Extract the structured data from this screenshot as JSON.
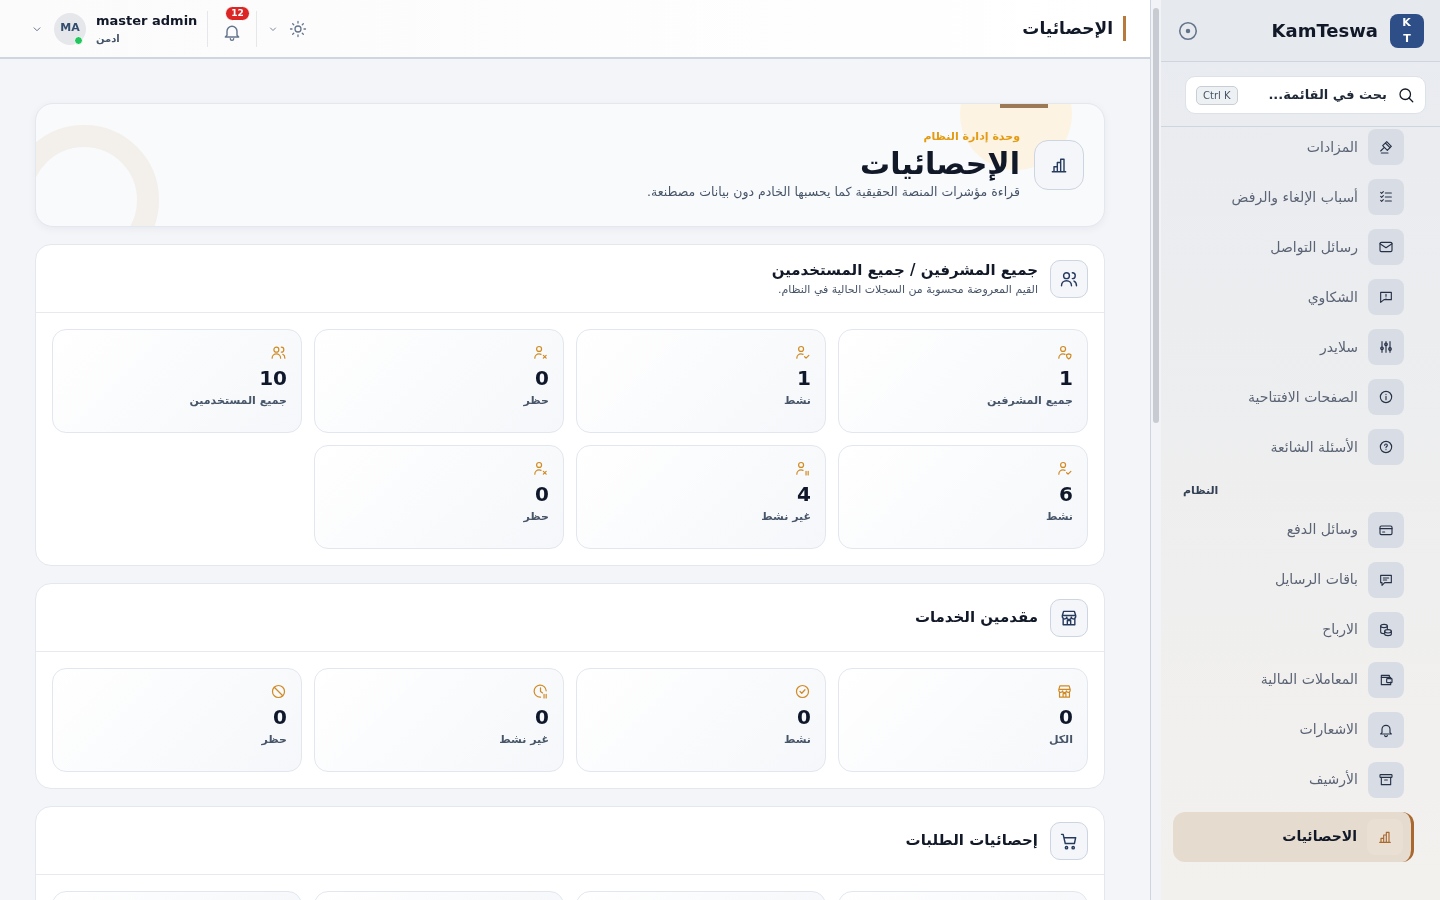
{
  "header": {
    "title": "الإحصائيات",
    "user": {
      "name": "master admin",
      "role": "ادمن",
      "initials": "MA",
      "online": true
    },
    "notifications": {
      "count": "12"
    }
  },
  "hero": {
    "eyebrow": "وحدة إدارة النظام",
    "title": "الإحصائيات",
    "description": "قراءة مؤشرات المنصة الحقيقية كما يحسبها الخادم دون بيانات مصطنعة."
  },
  "sections": [
    {
      "title": "جميع المشرفين / جميع المستخدمين",
      "subtitle": "القيم المعروضة محسوبة من السجلات الحالية في النظام.",
      "cards": [
        {
          "kind": "stat",
          "value": "1",
          "label": "جميع المشرفين"
        },
        {
          "kind": "stat",
          "value": "1",
          "label": "نشط"
        },
        {
          "kind": "stat",
          "value": "0",
          "label": "حظر"
        },
        {
          "kind": "stat",
          "value": "10",
          "label": "جميع المستخدمين"
        },
        {
          "kind": "stat",
          "value": "6",
          "label": "نشط"
        },
        {
          "kind": "stat",
          "value": "4",
          "label": "غير نشط"
        },
        {
          "kind": "stat",
          "value": "0",
          "label": "حظر"
        }
      ]
    },
    {
      "title": "مقدمين الخدمات",
      "cards": [
        {
          "kind": "stat",
          "value": "0",
          "label": "الكل"
        },
        {
          "kind": "stat",
          "value": "0",
          "label": "نشط"
        },
        {
          "kind": "stat",
          "value": "0",
          "label": "غير نشط"
        },
        {
          "kind": "stat",
          "value": "0",
          "label": "حظر"
        }
      ]
    },
    {
      "title": "إحصائيات الطلبات",
      "cards": [
        {
          "kind": "cut"
        },
        {
          "kind": "cut"
        },
        {
          "kind": "cut"
        },
        {
          "kind": "cut"
        }
      ]
    }
  ],
  "sidebar": {
    "logo": "KT",
    "brand": "KamTeswa",
    "search": {
      "placeholder": "بحث في القائمة...",
      "shortcut": "Ctrl K"
    },
    "groups": [
      {
        "items": [
          {
            "label": "المزادات",
            "selected": false
          },
          {
            "label": "أسباب الإلغاء والرفض",
            "selected": false
          },
          {
            "label": "رسائل التواصل",
            "selected": false
          },
          {
            "label": "الشكاوي",
            "selected": false
          },
          {
            "label": "سلايدر",
            "selected": false
          },
          {
            "label": "الصفحات الافتتاحية",
            "selected": false
          },
          {
            "label": "الأسئلة الشائعة",
            "selected": false
          }
        ]
      },
      {
        "label": "النظام",
        "items": [
          {
            "label": "وسائل الدفع",
            "selected": false
          },
          {
            "label": "باقات الرسايل",
            "selected": false
          },
          {
            "label": "الارباح",
            "selected": false
          },
          {
            "label": "المعاملات المالية",
            "selected": false
          },
          {
            "label": "الاشعارات",
            "selected": false
          },
          {
            "label": "الأرشيف",
            "selected": false
          },
          {
            "label": "الاحصائيات",
            "selected": true
          }
        ]
      }
    ]
  }
}
